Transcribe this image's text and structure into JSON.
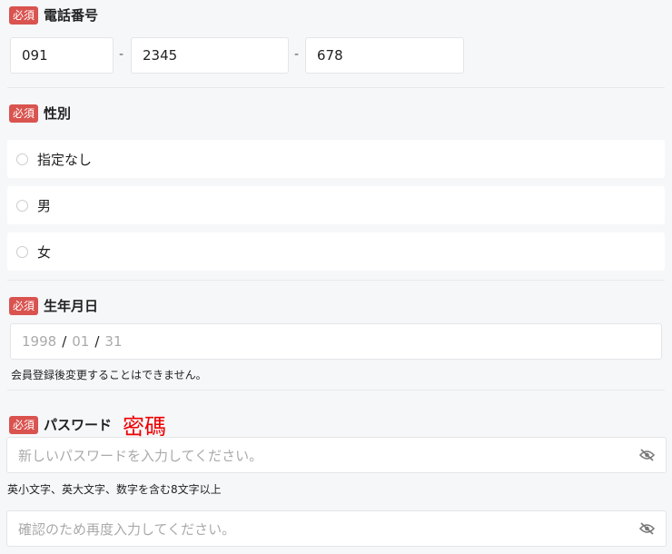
{
  "required_label": "必須",
  "phone": {
    "label": "電話番号",
    "parts": [
      "091",
      "2345",
      "678"
    ],
    "separator": "-"
  },
  "gender": {
    "label": "性別",
    "options": [
      "指定なし",
      "男",
      "女"
    ]
  },
  "birthday": {
    "label": "生年月日",
    "year": "1998",
    "month": "01",
    "day": "31",
    "separator": "/",
    "note": "会員登録後変更することはできません。"
  },
  "password": {
    "label": "パスワード",
    "annotation": "密碼",
    "placeholder": "新しいパスワードを入力してください。",
    "hint": "英小文字、英大文字、数字を含む8文字以上",
    "confirm_placeholder": "確認のため再度入力してください。"
  }
}
